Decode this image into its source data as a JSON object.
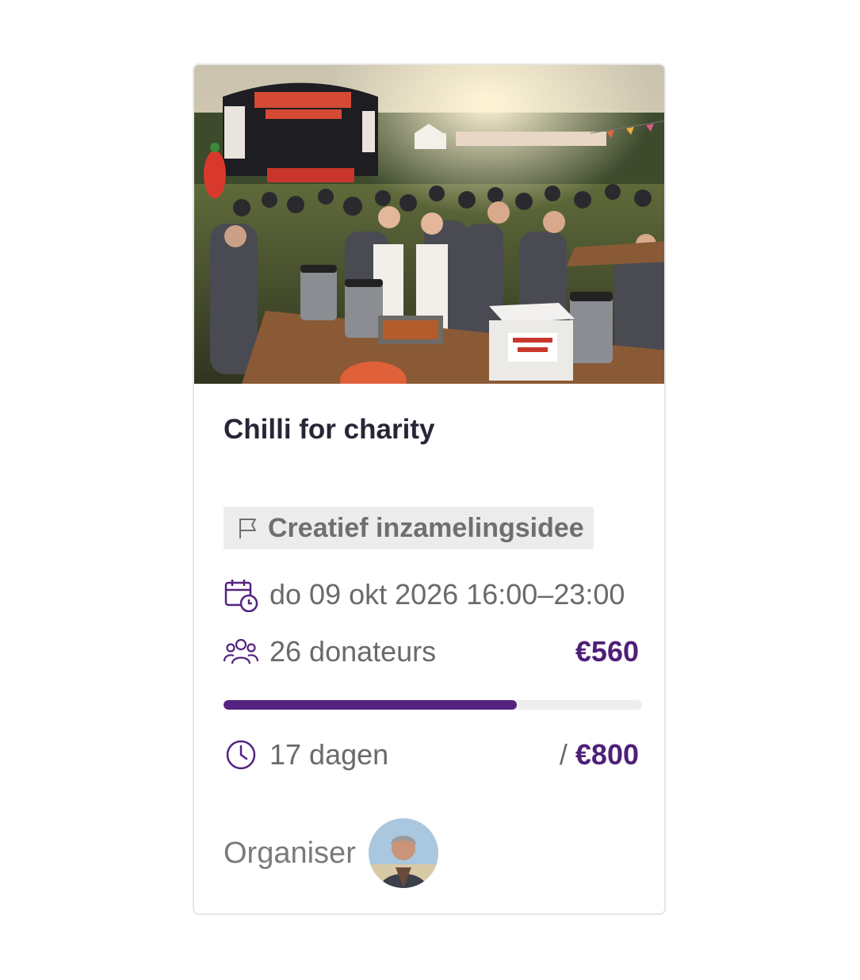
{
  "card": {
    "title": "Chilli for charity",
    "image_alt": "Chilli for charity event photo",
    "category": {
      "icon": "flag-icon",
      "label": "Creatief inzamelingsidee"
    },
    "date": {
      "icon": "calendar-clock-icon",
      "text": "do 09 okt 2026 16:00–23:00"
    },
    "donors": {
      "icon": "users-icon",
      "text": "26 donateurs"
    },
    "raised": "€560",
    "progress": 0.7,
    "remaining": {
      "icon": "clock-icon",
      "text": "17 dagen"
    },
    "goal_prefix": "/ ",
    "goal": "€800",
    "organiser_label": "Organiser"
  },
  "colors": {
    "accent": "#4e1f78",
    "progress_fill": "#53237f",
    "progress_track": "#eeeeee"
  }
}
